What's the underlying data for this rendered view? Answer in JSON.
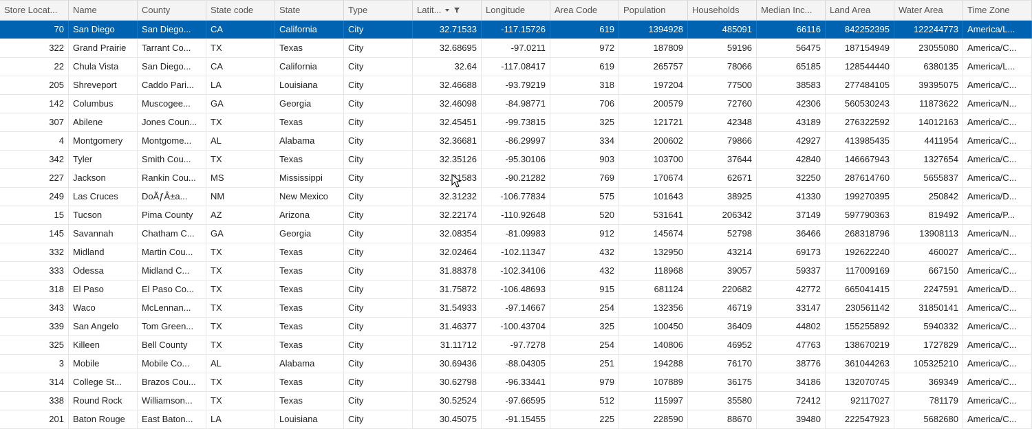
{
  "columns": [
    {
      "id": "store_loc",
      "label": "Store Locat...",
      "align": "num",
      "sorted": false,
      "filtered": false
    },
    {
      "id": "name",
      "label": "Name",
      "align": "txt",
      "sorted": false,
      "filtered": false
    },
    {
      "id": "county",
      "label": "County",
      "align": "txt",
      "sorted": false,
      "filtered": false
    },
    {
      "id": "state_code",
      "label": "State code",
      "align": "txt",
      "sorted": false,
      "filtered": false
    },
    {
      "id": "state",
      "label": "State",
      "align": "txt",
      "sorted": false,
      "filtered": false
    },
    {
      "id": "type",
      "label": "Type",
      "align": "txt",
      "sorted": false,
      "filtered": false
    },
    {
      "id": "latitude",
      "label": "Latit...",
      "align": "num",
      "sorted": true,
      "filtered": true
    },
    {
      "id": "longitude",
      "label": "Longitude",
      "align": "num",
      "sorted": false,
      "filtered": false
    },
    {
      "id": "area_code",
      "label": "Area Code",
      "align": "num",
      "sorted": false,
      "filtered": false
    },
    {
      "id": "population",
      "label": "Population",
      "align": "num",
      "sorted": false,
      "filtered": false
    },
    {
      "id": "households",
      "label": "Households",
      "align": "num",
      "sorted": false,
      "filtered": false
    },
    {
      "id": "median_inc",
      "label": "Median Inc...",
      "align": "num",
      "sorted": false,
      "filtered": false
    },
    {
      "id": "land_area",
      "label": "Land Area",
      "align": "num",
      "sorted": false,
      "filtered": false
    },
    {
      "id": "water_area",
      "label": "Water Area",
      "align": "num",
      "sorted": false,
      "filtered": false
    },
    {
      "id": "time_zone",
      "label": "Time Zone",
      "align": "txt",
      "sorted": false,
      "filtered": false
    }
  ],
  "rows": [
    {
      "selected": true,
      "cells": [
        "70",
        "San Diego",
        "San Diego...",
        "CA",
        "California",
        "City",
        "32.71533",
        "-117.15726",
        "619",
        "1394928",
        "485091",
        "66116",
        "842252395",
        "122244773",
        "America/L..."
      ]
    },
    {
      "selected": false,
      "cells": [
        "322",
        "Grand Prairie",
        "Tarrant Co...",
        "TX",
        "Texas",
        "City",
        "32.68695",
        "-97.0211",
        "972",
        "187809",
        "59196",
        "56475",
        "187154949",
        "23055080",
        "America/C..."
      ]
    },
    {
      "selected": false,
      "cells": [
        "22",
        "Chula Vista",
        "San Diego...",
        "CA",
        "California",
        "City",
        "32.64",
        "-117.08417",
        "619",
        "265757",
        "78066",
        "65185",
        "128544440",
        "6380135",
        "America/L..."
      ]
    },
    {
      "selected": false,
      "cells": [
        "205",
        "Shreveport",
        "Caddo Pari...",
        "LA",
        "Louisiana",
        "City",
        "32.46688",
        "-93.79219",
        "318",
        "197204",
        "77500",
        "38583",
        "277484105",
        "39395075",
        "America/C..."
      ]
    },
    {
      "selected": false,
      "cells": [
        "142",
        "Columbus",
        "Muscogee...",
        "GA",
        "Georgia",
        "City",
        "32.46098",
        "-84.98771",
        "706",
        "200579",
        "72760",
        "42306",
        "560530243",
        "11873622",
        "America/N..."
      ]
    },
    {
      "selected": false,
      "cells": [
        "307",
        "Abilene",
        "Jones Coun...",
        "TX",
        "Texas",
        "City",
        "32.45451",
        "-99.73815",
        "325",
        "121721",
        "42348",
        "43189",
        "276322592",
        "14012163",
        "America/C..."
      ]
    },
    {
      "selected": false,
      "cells": [
        "4",
        "Montgomery",
        "Montgome...",
        "AL",
        "Alabama",
        "City",
        "32.36681",
        "-86.29997",
        "334",
        "200602",
        "79866",
        "42927",
        "413985435",
        "4411954",
        "America/C..."
      ]
    },
    {
      "selected": false,
      "cells": [
        "342",
        "Tyler",
        "Smith Cou...",
        "TX",
        "Texas",
        "City",
        "32.35126",
        "-95.30106",
        "903",
        "103700",
        "37644",
        "42840",
        "146667943",
        "1327654",
        "America/C..."
      ]
    },
    {
      "selected": false,
      "cells": [
        "227",
        "Jackson",
        "Rankin Cou...",
        "MS",
        "Mississippi",
        "City",
        "32.31583",
        "-90.21282",
        "769",
        "170674",
        "62671",
        "32250",
        "287614760",
        "5655837",
        "America/C..."
      ]
    },
    {
      "selected": false,
      "cells": [
        "249",
        "Las Cruces",
        "DoÃƒÂ±a...",
        "NM",
        "New Mexico",
        "City",
        "32.31232",
        "-106.77834",
        "575",
        "101643",
        "38925",
        "41330",
        "199270395",
        "250842",
        "America/D..."
      ]
    },
    {
      "selected": false,
      "cells": [
        "15",
        "Tucson",
        "Pima County",
        "AZ",
        "Arizona",
        "City",
        "32.22174",
        "-110.92648",
        "520",
        "531641",
        "206342",
        "37149",
        "597790363",
        "819492",
        "America/P..."
      ]
    },
    {
      "selected": false,
      "cells": [
        "145",
        "Savannah",
        "Chatham C...",
        "GA",
        "Georgia",
        "City",
        "32.08354",
        "-81.09983",
        "912",
        "145674",
        "52798",
        "36466",
        "268318796",
        "13908113",
        "America/N..."
      ]
    },
    {
      "selected": false,
      "cells": [
        "332",
        "Midland",
        "Martin Cou...",
        "TX",
        "Texas",
        "City",
        "32.02464",
        "-102.11347",
        "432",
        "132950",
        "43214",
        "69173",
        "192622240",
        "460027",
        "America/C..."
      ]
    },
    {
      "selected": false,
      "cells": [
        "333",
        "Odessa",
        "Midland C...",
        "TX",
        "Texas",
        "City",
        "31.88378",
        "-102.34106",
        "432",
        "118968",
        "39057",
        "59337",
        "117009169",
        "667150",
        "America/C..."
      ]
    },
    {
      "selected": false,
      "cells": [
        "318",
        "El Paso",
        "El Paso Co...",
        "TX",
        "Texas",
        "City",
        "31.75872",
        "-106.48693",
        "915",
        "681124",
        "220682",
        "42772",
        "665041415",
        "2247591",
        "America/D..."
      ]
    },
    {
      "selected": false,
      "cells": [
        "343",
        "Waco",
        "McLennan...",
        "TX",
        "Texas",
        "City",
        "31.54933",
        "-97.14667",
        "254",
        "132356",
        "46719",
        "33147",
        "230561142",
        "31850141",
        "America/C..."
      ]
    },
    {
      "selected": false,
      "cells": [
        "339",
        "San Angelo",
        "Tom Green...",
        "TX",
        "Texas",
        "City",
        "31.46377",
        "-100.43704",
        "325",
        "100450",
        "36409",
        "44802",
        "155255892",
        "5940332",
        "America/C..."
      ]
    },
    {
      "selected": false,
      "cells": [
        "325",
        "Killeen",
        "Bell County",
        "TX",
        "Texas",
        "City",
        "31.11712",
        "-97.7278",
        "254",
        "140806",
        "46952",
        "47763",
        "138670219",
        "1727829",
        "America/C..."
      ]
    },
    {
      "selected": false,
      "cells": [
        "3",
        "Mobile",
        "Mobile Co...",
        "AL",
        "Alabama",
        "City",
        "30.69436",
        "-88.04305",
        "251",
        "194288",
        "76170",
        "38776",
        "361044263",
        "105325210",
        "America/C..."
      ]
    },
    {
      "selected": false,
      "cells": [
        "314",
        "College St...",
        "Brazos Cou...",
        "TX",
        "Texas",
        "City",
        "30.62798",
        "-96.33441",
        "979",
        "107889",
        "36175",
        "34186",
        "132070745",
        "369349",
        "America/C..."
      ]
    },
    {
      "selected": false,
      "cells": [
        "338",
        "Round Rock",
        "Williamson...",
        "TX",
        "Texas",
        "City",
        "30.52524",
        "-97.66595",
        "512",
        "115997",
        "35580",
        "72412",
        "92117027",
        "781179",
        "America/C..."
      ]
    },
    {
      "selected": false,
      "cells": [
        "201",
        "Baton Rouge",
        "East Baton...",
        "LA",
        "Louisiana",
        "City",
        "30.45075",
        "-91.15455",
        "225",
        "228590",
        "88670",
        "39480",
        "222547923",
        "5682680",
        "America/C..."
      ]
    }
  ]
}
